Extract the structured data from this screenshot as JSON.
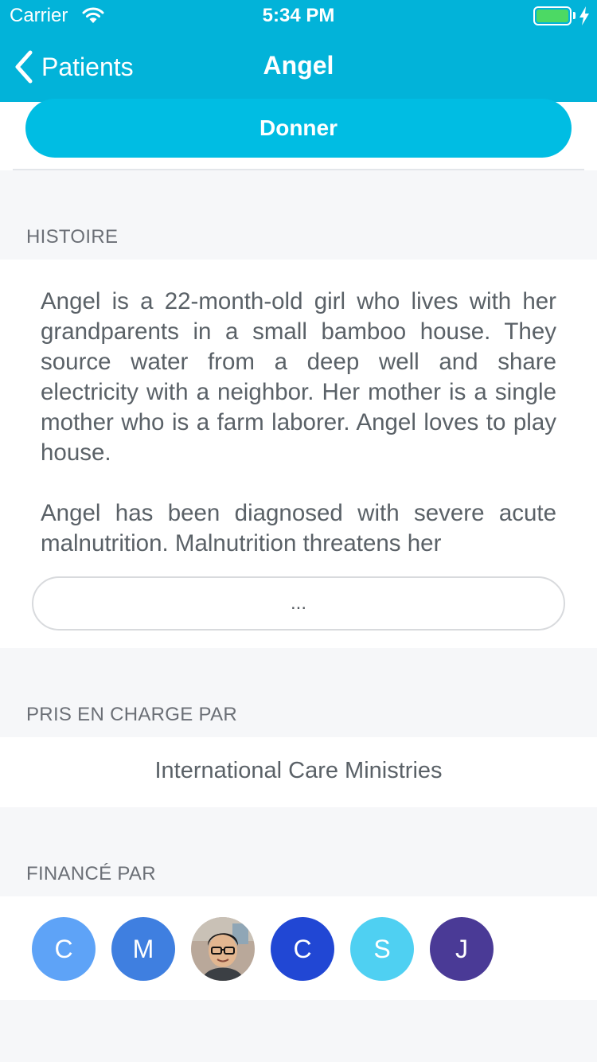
{
  "status_bar": {
    "carrier": "Carrier",
    "time": "5:34 PM",
    "battery_level": 1.0
  },
  "nav": {
    "back_label": "Patients",
    "title": "Angel"
  },
  "donate": {
    "label": "Donner",
    "color": "#00bde3"
  },
  "story": {
    "header": "HISTOIRE",
    "text": "Angel is a 22-month-old girl who lives with her grandparents in a small bamboo house. They source water from a deep well and share electricity with a neighbor.   Her mother is a single mother who is a farm laborer. Angel loves to play house.\n\nAngel has been diagnosed with severe acute malnutrition. Malnutrition threatens her",
    "more_label": "..."
  },
  "supported_by": {
    "header": "PRIS EN CHARGE PAR",
    "organization": "International Care Ministries"
  },
  "funded_by": {
    "header": "FINANCÉ PAR",
    "funders": [
      {
        "initial": "C",
        "color": "#5ea3f7"
      },
      {
        "initial": "M",
        "color": "#3f7fe0"
      },
      {
        "initial": "",
        "icon": "user-photo"
      },
      {
        "initial": "C",
        "color": "#2147d4"
      },
      {
        "initial": "S",
        "color": "#4fd0f2"
      },
      {
        "initial": "J",
        "color": "#4a3a96"
      }
    ]
  },
  "colors": {
    "accent": "#02b3d9",
    "background": "#f6f7f9"
  }
}
